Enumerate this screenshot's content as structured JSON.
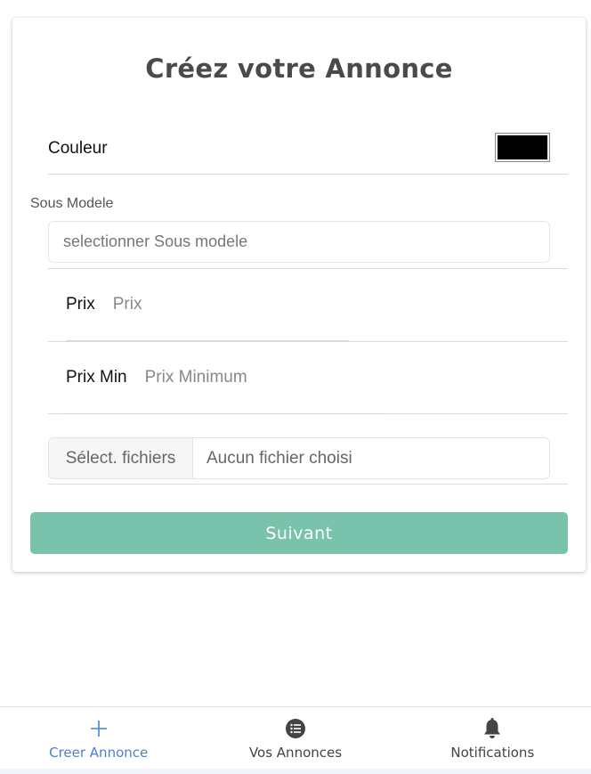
{
  "page": {
    "title": "Créez votre Annonce"
  },
  "form": {
    "couleur_label": "Couleur",
    "couleur_value": "#000000",
    "sous_modele_label": "Sous Modele",
    "sous_modele_placeholder": "selectionner Sous modele",
    "prix_label": "Prix",
    "prix_placeholder": "Prix",
    "prix_min_label": "Prix Min",
    "prix_min_placeholder": "Prix Minimum",
    "file_button_label": "Sélect. fichiers",
    "file_status": "Aucun fichier choisi",
    "submit_label": "Suivant"
  },
  "nav": {
    "items": [
      {
        "label": "Creer Annonce",
        "icon": "plus-icon",
        "active": true
      },
      {
        "label": "Vos Annonces",
        "icon": "list-icon",
        "active": false
      },
      {
        "label": "Notifications",
        "icon": "bell-icon",
        "active": false
      }
    ]
  },
  "colors": {
    "accent": "#79c2ab",
    "nav_active": "#4a7fd6"
  }
}
